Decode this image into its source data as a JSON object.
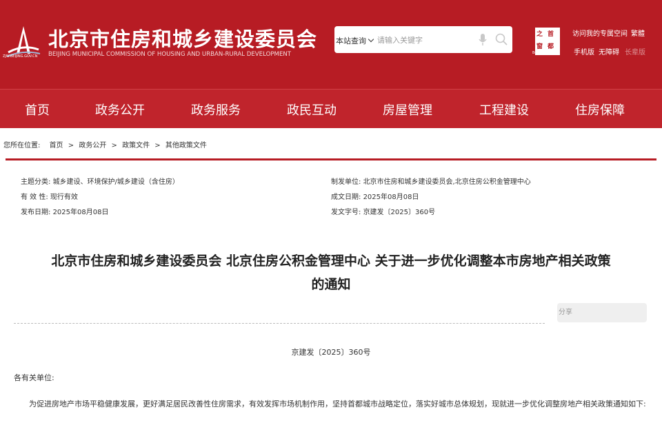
{
  "header": {
    "logo_url": "ZJW.BEIJING.GOV.CN",
    "title": "北京市住房和城乡建设委员会",
    "subtitle": "BEIJING MUNICIPAL COMMISSION OF HOUSING AND URBAN-RURAL DEVELOPMENT",
    "search_scope": "本站查询",
    "search_placeholder": "请输入关键字",
    "emblem_chars": [
      "首",
      "之",
      "都",
      "窗"
    ],
    "emblem_caption": "Beijing·China",
    "top_links": [
      "访问我的专属空间",
      "繁體",
      "手机版",
      "无障碍",
      "长辈版"
    ]
  },
  "nav": {
    "items": [
      "首页",
      "政务公开",
      "政务服务",
      "政民互动",
      "房屋管理",
      "工程建设",
      "住房保障"
    ]
  },
  "breadcrumb": {
    "prefix": "您所在位置:",
    "items": [
      "首页",
      ">",
      "政务公开",
      ">",
      "政策文件",
      ">",
      "其他政策文件"
    ]
  },
  "meta": {
    "topic_label": "主题分类:",
    "topic_value": "城乡建设、环境保护/城乡建设（含住房）",
    "validity_label": "有 效 性:",
    "validity_value": "现行有效",
    "publish_label": "发布日期:",
    "publish_value": "2025年08月08日",
    "issuer_label": "制发单位:",
    "issuer_value": "北京市住房和城乡建设委员会,北京住房公积金管理中心",
    "made_label": "成文日期:",
    "made_value": "2025年08月08日",
    "docno_label": "发文字号:",
    "docno_value": "京建发〔2025〕360号"
  },
  "document": {
    "title_line1": "北京市住房和城乡建设委员会 北京住房公积金管理中心 关于进一步优化调整本市房地产相关政策",
    "title_line2": "的通知",
    "share_label": "分享",
    "number": "京建发〔2025〕360号",
    "salutation": "各有关单位:",
    "body": "为促进房地产市场平稳健康发展，更好满足居民改善性住房需求，有效发挥市场机制作用，坚持首都城市战略定位，落实好城市总体规划，现就进一步优化调整房地产相关政策通知如下:"
  }
}
